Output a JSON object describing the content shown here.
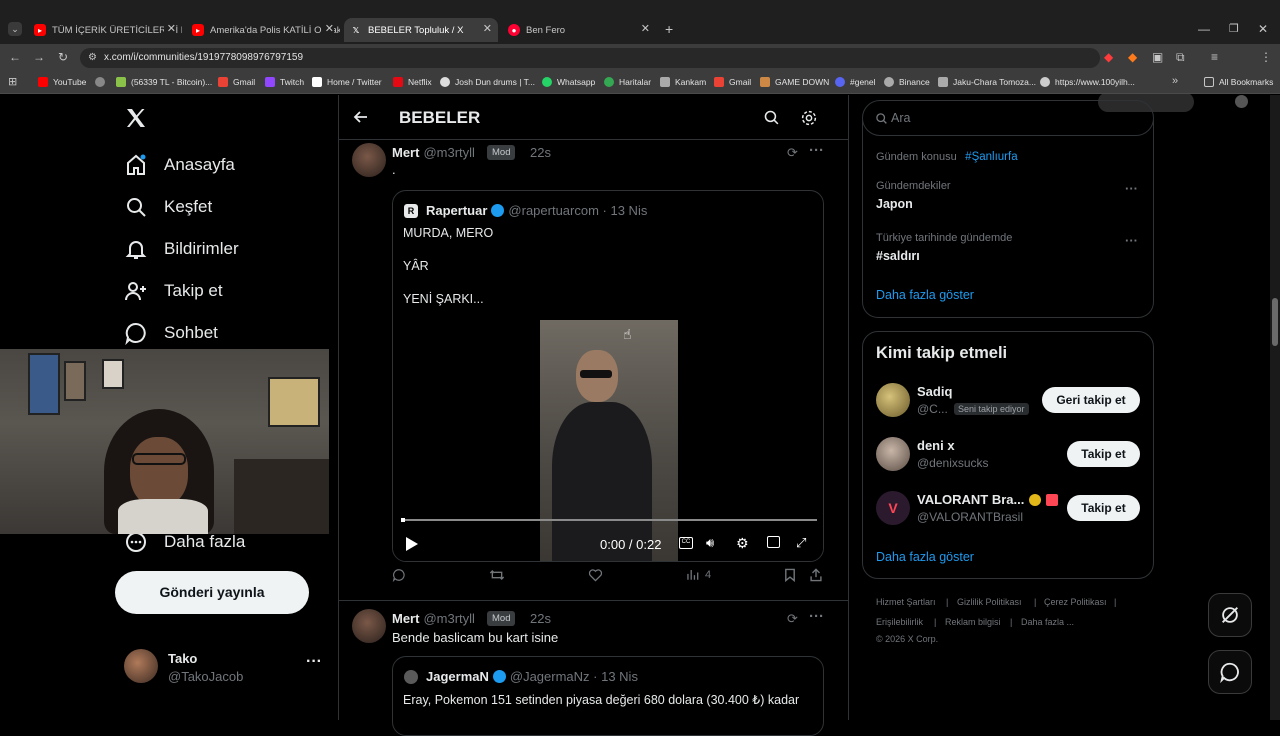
{
  "browser": {
    "tabs": [
      {
        "title": "TÜM İÇERİK ÜRETİCİLERİNİ KAN",
        "fav_color": "#ff0000"
      },
      {
        "title": "Amerika'da Polis KATİLİ Olmak",
        "fav_color": "#ff0000"
      },
      {
        "title": "BEBELER Topluluk / X",
        "fav_color": "#ffffff"
      },
      {
        "title": "Ben Fero",
        "fav_color": "#ff0033"
      }
    ],
    "url": "x.com/i/communities/1919778098976797159",
    "bookmarks": [
      {
        "label": "YouTube",
        "color": "#ff0000"
      },
      {
        "label": "",
        "color": "#888888"
      },
      {
        "label": "(56339 TL - Bitcoin)...",
        "color": "#8bc34a"
      },
      {
        "label": "Gmail",
        "color": "#ea4335"
      },
      {
        "label": "Twitch",
        "color": "#9146ff"
      },
      {
        "label": "Home / Twitter",
        "color": "#ffffff"
      },
      {
        "label": "Netflix",
        "color": "#e50914"
      },
      {
        "label": "Josh Dun drums | T...",
        "color": "#dddddd"
      },
      {
        "label": "Whatsapp",
        "color": "#25d366"
      },
      {
        "label": "Haritalar",
        "color": "#34a853"
      },
      {
        "label": "Kankam",
        "color": "#aaaaaa"
      },
      {
        "label": "Gmail",
        "color": "#ea4335"
      },
      {
        "label": "GAME DOWN",
        "color": "#cc8844"
      },
      {
        "label": "#genel",
        "color": "#5865f2"
      },
      {
        "label": "Binance",
        "color": "#aaaaaa"
      },
      {
        "label": "Jaku-Chara Tomoza...",
        "color": "#aaaaaa"
      },
      {
        "label": "https://www.100yilh...",
        "color": "#cccccc"
      }
    ],
    "all_bookmarks": "All Bookmarks"
  },
  "nav": {
    "items": [
      "Anasayfa",
      "Keşfet",
      "Bildirimler",
      "Takip et",
      "Sohbet",
      "Daha fazla"
    ],
    "post_button": "Gönderi yayınla",
    "profile_name": "Tako",
    "profile_handle": "@TakoJacob"
  },
  "header": {
    "title": "BEBELER"
  },
  "posts": [
    {
      "name": "Mert",
      "handle": "@m3rtyll",
      "badge": "Mod",
      "time": "22s",
      "text": ".",
      "quote": {
        "name": "Rapertuar",
        "handle": "@rapertuarcom · 13 Nis",
        "line1": "MURDA, MERO",
        "line2": "YÂR",
        "line3": "YENİ ŞARKI..."
      },
      "video_time": "0:00 / 0:22",
      "views": "4"
    },
    {
      "name": "Mert",
      "handle": "@m3rtyll",
      "badge": "Mod",
      "time": "22s",
      "text": "Bende baslicam bu kart isine",
      "quote": {
        "name": "JagermaN",
        "handle": "@JagermaNz · 13 Nis",
        "line1": "Eray, Pokemon 151 setinden piyasa değeri 680 dolara (30.400 ₺) kadar"
      }
    }
  ],
  "right": {
    "search_placeholder": "Ara",
    "trends": [
      {
        "context": "Gündem konusu",
        "tag": "#Şanlıurfa"
      },
      {
        "context": "Gündemdekiler",
        "title": "Japon"
      },
      {
        "context": "Türkiye tarihinde gündemde",
        "title": "#saldırı"
      }
    ],
    "show_more": "Daha fazla göster",
    "who_to_follow": {
      "title": "Kimi takip etmeli",
      "users": [
        {
          "name": "Sadiq",
          "handle": "@C...",
          "note": "Seni takip ediyor",
          "button": "Geri takip et"
        },
        {
          "name": "deni x",
          "handle": "@denixsucks",
          "button": "Takip et"
        },
        {
          "name": "VALORANT Bra...",
          "handle": "@VALORANTBrasil",
          "button": "Takip et"
        }
      ],
      "show_more": "Daha fazla göster"
    },
    "footer": {
      "links": [
        "Hizmet Şartları",
        "Gizlilik Politikası",
        "Çerez Politikası",
        "Erişilebilirlik",
        "Reklam bilgisi",
        "Daha fazla ..."
      ],
      "copyright": "© 2026 X Corp."
    }
  },
  "colors": {
    "accent": "#1d9bf0",
    "background": "#000000",
    "border": "#2f3336"
  }
}
